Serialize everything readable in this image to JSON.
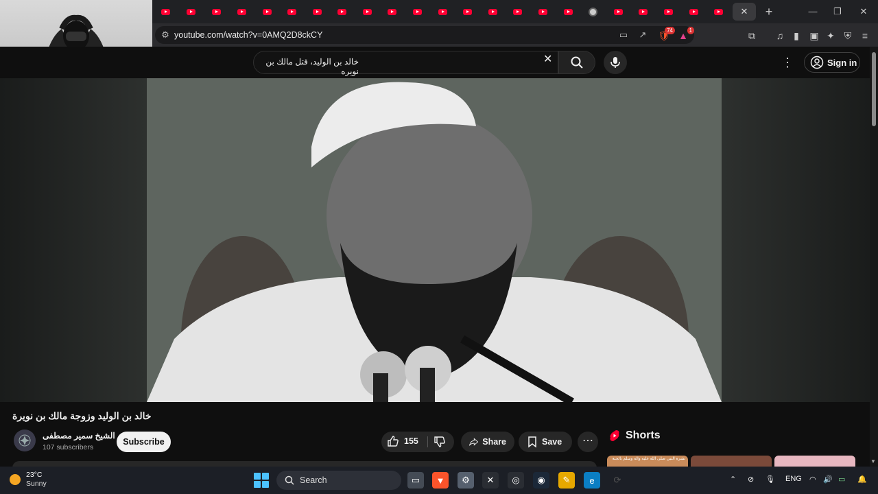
{
  "browser": {
    "tabs_count": 23,
    "active_tab_close": "✕",
    "new_tab": "+",
    "url": "youtube.com/watch?v=0AMQ2D8ckCY",
    "shields_badge": "74",
    "rewards_badge": "1"
  },
  "header": {
    "search_query": "خالد بن الوليد، قتل مالك بن نويره",
    "sign_in": "Sign in"
  },
  "video": {
    "title": "خالد بن الوليد وزوجة مالك بن نويرة"
  },
  "channel": {
    "name": "الشيخ سمير مصطفى",
    "subscribers": "107 subscribers",
    "subscribe_label": "Subscribe"
  },
  "actions": {
    "likes": "155",
    "share": "Share",
    "save": "Save"
  },
  "shorts": {
    "heading": "Shorts",
    "thumbs": [
      {
        "caption": "نشرة النبي صلى الله عليه وآله وسلم بالجنة"
      },
      {
        "caption": ""
      },
      {
        "caption": ""
      }
    ]
  },
  "taskbar": {
    "temperature": "23°C",
    "condition": "Sunny",
    "search_label": "Search",
    "language": "ENG"
  },
  "colors": {
    "youtube_red": "#ff0033",
    "page_bg": "#0f0f0f",
    "pill_bg": "#272727",
    "start_blue": "#4cc2ff"
  }
}
